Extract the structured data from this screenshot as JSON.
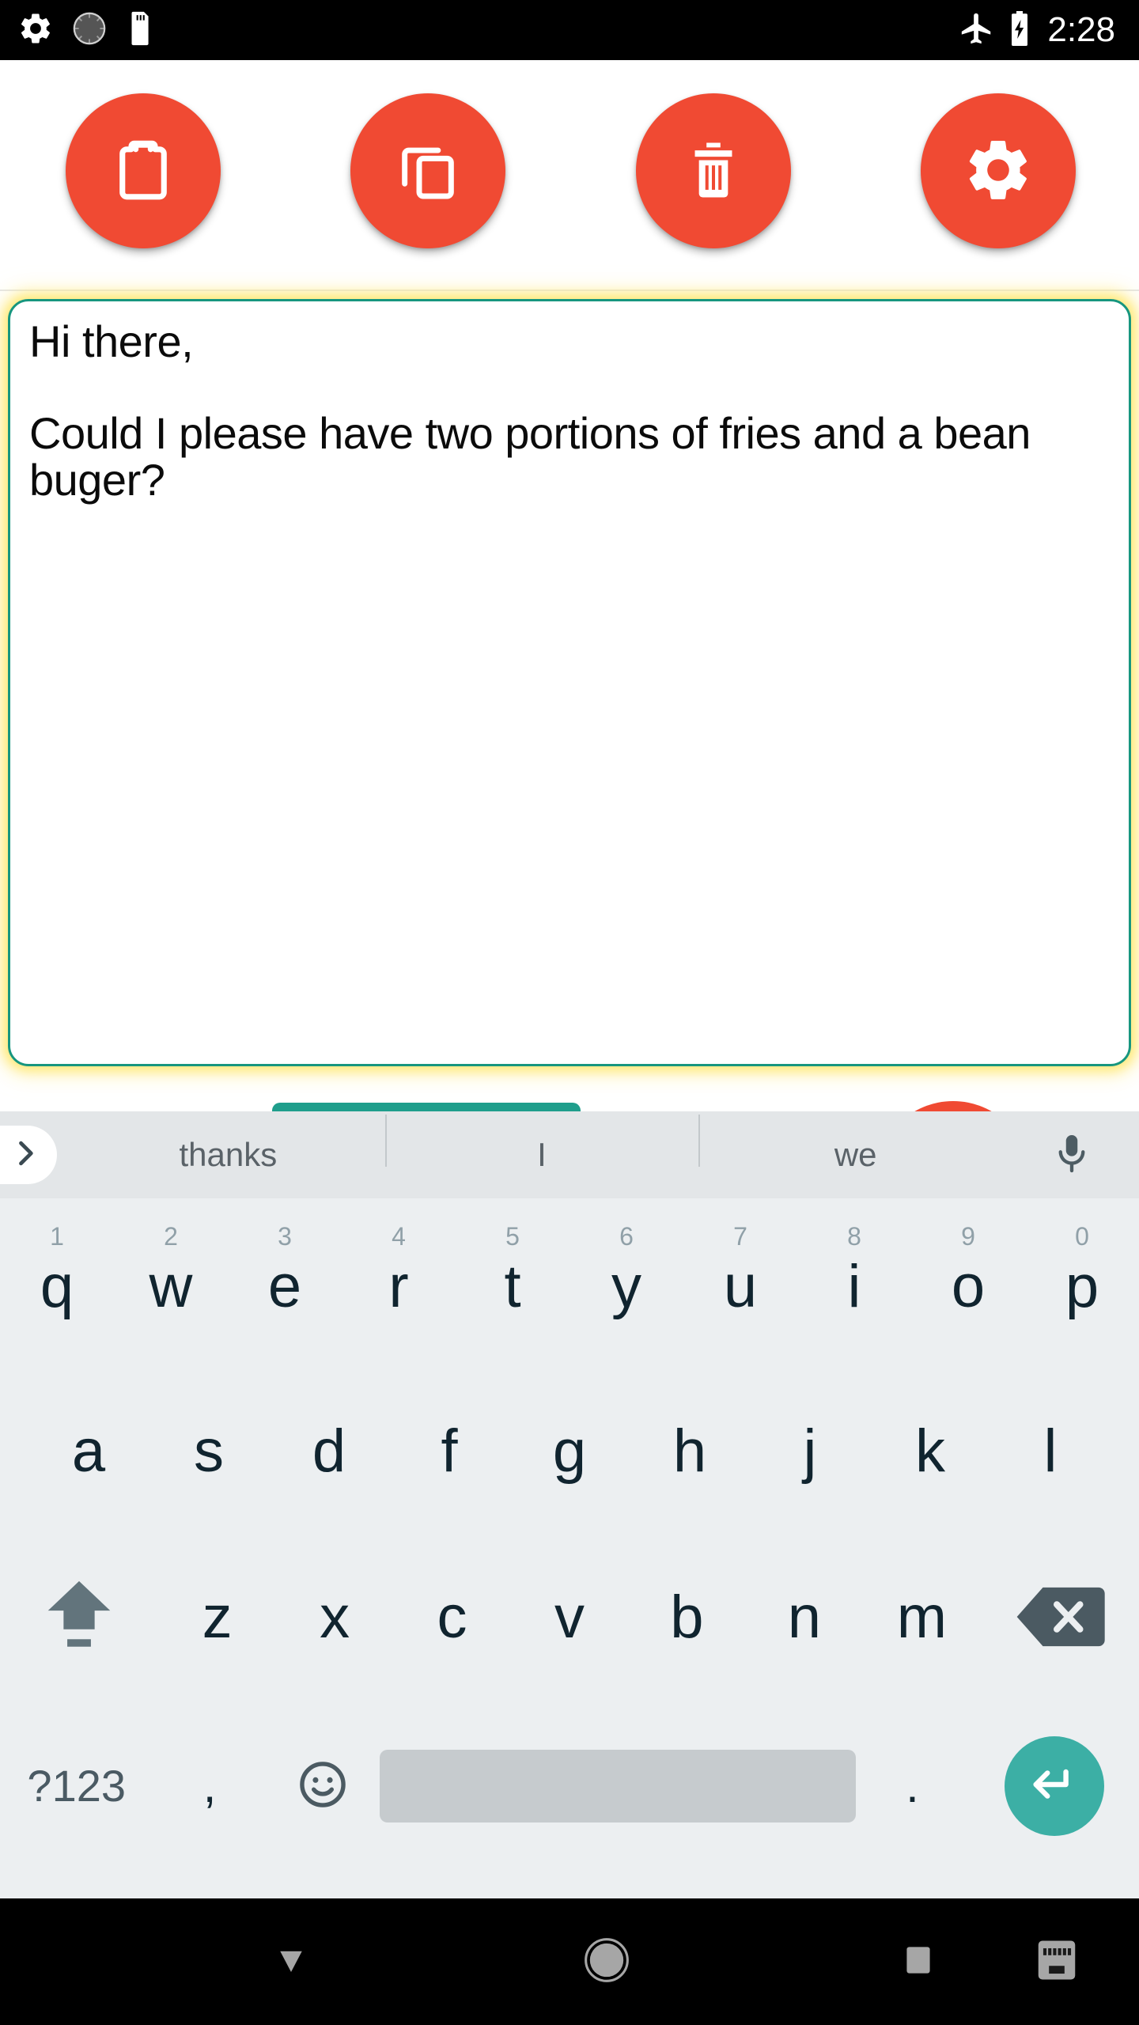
{
  "statusbar": {
    "icons_left": [
      "gear-icon",
      "dial-icon",
      "sd-card-icon"
    ],
    "icons_right": [
      "airplane-mode-icon",
      "battery-charging-icon"
    ],
    "time": "2:28"
  },
  "toolbar": {
    "buttons": [
      {
        "name": "paste-button",
        "icon": "clipboard-icon"
      },
      {
        "name": "copy-button",
        "icon": "copy-icon"
      },
      {
        "name": "delete-button",
        "icon": "trash-icon"
      },
      {
        "name": "settings-button",
        "icon": "gear-icon"
      }
    ],
    "accent_color": "#F04A33"
  },
  "editor": {
    "text": "Hi there,\n\nCould I please have two portions of fries and a bean buger?",
    "placeholder": "",
    "border_color": "#17967F",
    "glow_color": "#FFE86E"
  },
  "keyboard": {
    "suggestions": {
      "expand_icon": "chevron-right-icon",
      "items": [
        "thanks",
        "I",
        "we"
      ],
      "mic_icon": "microphone-icon"
    },
    "row1": [
      {
        "char": "q",
        "num": "1"
      },
      {
        "char": "w",
        "num": "2"
      },
      {
        "char": "e",
        "num": "3"
      },
      {
        "char": "r",
        "num": "4"
      },
      {
        "char": "t",
        "num": "5"
      },
      {
        "char": "y",
        "num": "6"
      },
      {
        "char": "u",
        "num": "7"
      },
      {
        "char": "i",
        "num": "8"
      },
      {
        "char": "o",
        "num": "9"
      },
      {
        "char": "p",
        "num": "0"
      }
    ],
    "row2": [
      {
        "char": "a"
      },
      {
        "char": "s"
      },
      {
        "char": "d"
      },
      {
        "char": "f"
      },
      {
        "char": "g"
      },
      {
        "char": "h"
      },
      {
        "char": "j"
      },
      {
        "char": "k"
      },
      {
        "char": "l"
      }
    ],
    "row3": {
      "shift_icon": "shift-icon",
      "keys": [
        {
          "char": "z"
        },
        {
          "char": "x"
        },
        {
          "char": "c"
        },
        {
          "char": "v"
        },
        {
          "char": "b"
        },
        {
          "char": "n"
        },
        {
          "char": "m"
        }
      ],
      "backspace_icon": "backspace-icon"
    },
    "row4": {
      "symbols_label": "?123",
      "comma": ",",
      "emoji_icon": "emoji-smiley-icon",
      "space_label": "",
      "period": ".",
      "enter_icon": "enter-return-icon"
    },
    "enter_color": "#3CAFA5",
    "background_color": "#ECEFF1"
  },
  "peek": {
    "button_color": "#1F9E8C",
    "fab_color": "#F04A33"
  },
  "navbar": {
    "buttons": [
      {
        "name": "nav-back-hide-keyboard-button",
        "icon": "triangle-down-icon"
      },
      {
        "name": "nav-home-button",
        "icon": "circle-home-icon"
      },
      {
        "name": "nav-recents-button",
        "icon": "square-recents-icon"
      },
      {
        "name": "nav-keyboard-switch-button",
        "icon": "keyboard-icon"
      }
    ]
  }
}
